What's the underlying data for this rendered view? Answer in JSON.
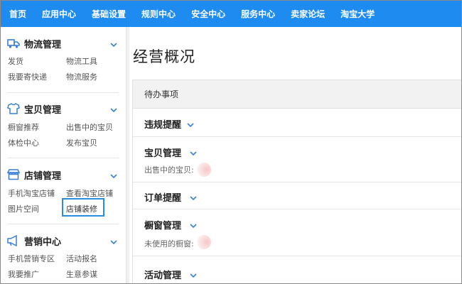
{
  "topnav": {
    "items": [
      "首页",
      "应用中心",
      "基础设置",
      "规则中心",
      "安全中心",
      "服务中心",
      "卖家论坛",
      "淘宝大学"
    ]
  },
  "sidebar": {
    "sections": [
      {
        "title": "物流管理",
        "icon": "truck-icon",
        "links": [
          "发货",
          "物流工具",
          "我要寄快递",
          "物流服务"
        ]
      },
      {
        "title": "宝贝管理",
        "icon": "shirt-icon",
        "links": [
          "橱窗推荐",
          "出售中的宝贝",
          "体检中心",
          "发布宝贝"
        ]
      },
      {
        "title": "店铺管理",
        "icon": "store-icon",
        "links": [
          "手机淘宝店铺",
          "查看淘宝店铺",
          "图片空间",
          "店铺装修"
        ]
      },
      {
        "title": "营销中心",
        "icon": "megaphone-icon",
        "links": [
          "手机营销专区",
          "活动报名",
          "我要推广",
          "生意参谋"
        ]
      }
    ],
    "highlighted_link": "店铺装修"
  },
  "main": {
    "title": "经营概况",
    "panel_header": "待办事项",
    "rows": [
      {
        "title": "违规提醒",
        "sub": ""
      },
      {
        "title": "宝贝管理",
        "sub": "出售中的宝贝:"
      },
      {
        "title": "订单提醒",
        "sub": ""
      },
      {
        "title": "橱窗管理",
        "sub": "未使用的橱窗:"
      },
      {
        "title": "活动管理",
        "sub": ""
      }
    ]
  },
  "colors": {
    "nav_bg": "#1e8bf0",
    "accent": "#2b8de0",
    "icon": "#3a7fd5"
  }
}
